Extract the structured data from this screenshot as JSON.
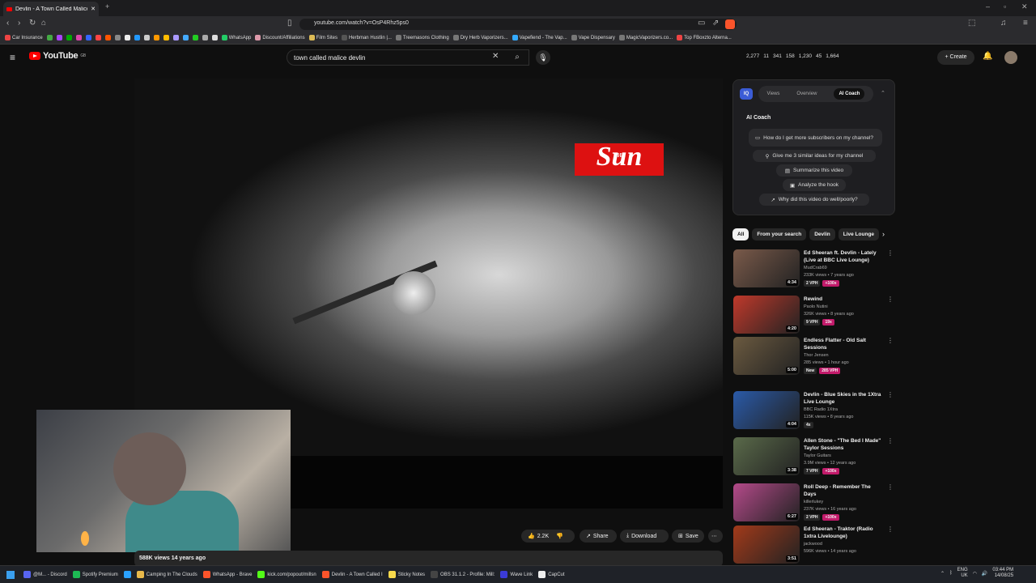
{
  "browser": {
    "tab_title": "Devlin - A Town Called Malice",
    "url": "youtube.com/watch?v=OsP4Rhz5ps0"
  },
  "bookmarks": [
    {
      "label": "Car Insurance",
      "color": "#e44"
    },
    {
      "label": "",
      "color": "#4a4"
    },
    {
      "label": "",
      "color": "#a4f"
    },
    {
      "label": "",
      "color": "#0a0"
    },
    {
      "label": "",
      "color": "#d4a"
    },
    {
      "label": "",
      "color": "#36f"
    },
    {
      "label": "",
      "color": "#f44"
    },
    {
      "label": "",
      "color": "#f50"
    },
    {
      "label": "",
      "color": "#888"
    },
    {
      "label": "",
      "color": "#eee"
    },
    {
      "label": "",
      "color": "#29f"
    },
    {
      "label": "",
      "color": "#ccc"
    },
    {
      "label": "",
      "color": "#f90"
    },
    {
      "label": "",
      "color": "#fb0"
    },
    {
      "label": "",
      "color": "#a9f"
    },
    {
      "label": "",
      "color": "#4af"
    },
    {
      "label": "",
      "color": "#2c2"
    },
    {
      "label": "",
      "color": "#aaa"
    },
    {
      "label": "",
      "color": "#ddd"
    },
    {
      "label": "WhatsApp",
      "color": "#2c6"
    },
    {
      "label": "Discount/Affiliations",
      "color": "#d9a"
    },
    {
      "label": "Film Sites",
      "color": "#db5"
    },
    {
      "label": "Herbman Hustlin |...",
      "color": "#555"
    },
    {
      "label": "Treemasons Clothing",
      "color": "#777"
    },
    {
      "label": "Dry Herb Vaporizers...",
      "color": "#777"
    },
    {
      "label": "Vapefiend - The Vap...",
      "color": "#3af"
    },
    {
      "label": "Vape Dispensary",
      "color": "#777"
    },
    {
      "label": "MagicVaporizers.co...",
      "color": "#777"
    },
    {
      "label": "Top FBoxzto Alterna...",
      "color": "#e44"
    }
  ],
  "header": {
    "logo": "YouTube",
    "logo_sup": "GB",
    "search_value": "town called malice devlin",
    "stats": [
      "2,277",
      "11",
      "341",
      "158",
      "1,230",
      "45",
      "1,664"
    ],
    "create_label": "Create"
  },
  "video": {
    "sun_logo": "Sun",
    "sun_small": "THE",
    "like_count": "2.2K",
    "share_label": "Share",
    "download_label": "Download",
    "save_label": "Save",
    "views_line": "588K views  14 years ago"
  },
  "panel": {
    "badge": "IQ",
    "tabs": [
      "Views",
      "Overview",
      "AI Coach"
    ],
    "title": "AI Coach",
    "questions": [
      "How do I get more subscribers on my channel?",
      "Give me 3 similar ideas for my channel",
      "Summarize this video",
      "Analyze the hook",
      "Why did this video do well/poorly?"
    ]
  },
  "chips": [
    "All",
    "From your search",
    "Devlin",
    "Live Lounge"
  ],
  "recommendations": [
    {
      "title": "Ed Sheeran ft. Devlin - Lately (Live at BBC Live Lounge)",
      "channel": "MudCrab69",
      "meta": "233K views • 7 years ago",
      "duration": "4:34",
      "badge1": "2 VPH",
      "badge2": "+100x",
      "thumb": "#7a5a4a"
    },
    {
      "title": "Rewind",
      "channel": "Paolo Nutini",
      "meta": "326K views • 8 years ago",
      "duration": "4:20",
      "badge1": "9 VPH",
      "badge2": "19x",
      "thumb": "#c0392b"
    },
    {
      "title": "Endless Flatter - Old Salt Sessions",
      "channel": "Thor Jensen",
      "meta": "285 views • 1 hour ago",
      "duration": "5:00",
      "badge1": "New",
      "badge2": "285 VPH",
      "thumb": "#6b5a40"
    },
    {
      "title": "Devlin - Blue Skies in the 1Xtra Live Lounge",
      "channel": "BBC Radio 1Xtra",
      "meta": "115K views • 8 years ago",
      "duration": "4:04",
      "badge1": "4x",
      "badge2": "",
      "thumb": "#2a5aa8"
    },
    {
      "title": "Allen Stone - \"The Bed I Made\" Taylor Sessions",
      "channel": "Taylor Guitars",
      "meta": "3.9M views • 12 years ago",
      "duration": "3:38",
      "badge1": "7 VPH",
      "badge2": "+100x",
      "thumb": "#5a6a4a"
    },
    {
      "title": "Roll Deep - Remember The Days",
      "channel": "killerlukey",
      "meta": "237K views • 16 years ago",
      "duration": "6:27",
      "badge1": "2 VPH",
      "badge2": "+100x",
      "thumb": "#b44a8a"
    },
    {
      "title": "Ed Sheeran - Traktor (Radio 1xtra Livelounge)",
      "channel": "jackwood",
      "meta": "596K views • 14 years ago",
      "duration": "3:51",
      "badge1": "",
      "badge2": "",
      "thumb": "#a23a1a"
    }
  ],
  "taskbar": [
    "@M... - Discord",
    "Spotify Premium",
    "",
    "Camping In The Clouds",
    "WhatsApp - Brave",
    "kick.com/popout/millsn",
    "Devlin - A Town Called I",
    "Sticky Notes",
    "OBS 31.1.2 - Profile: Mill:",
    "Wave Link",
    "CapCut"
  ],
  "tray": {
    "lang1": "ENG",
    "lang2": "UK",
    "time": "03:44 PM",
    "date": "14/08/25"
  }
}
